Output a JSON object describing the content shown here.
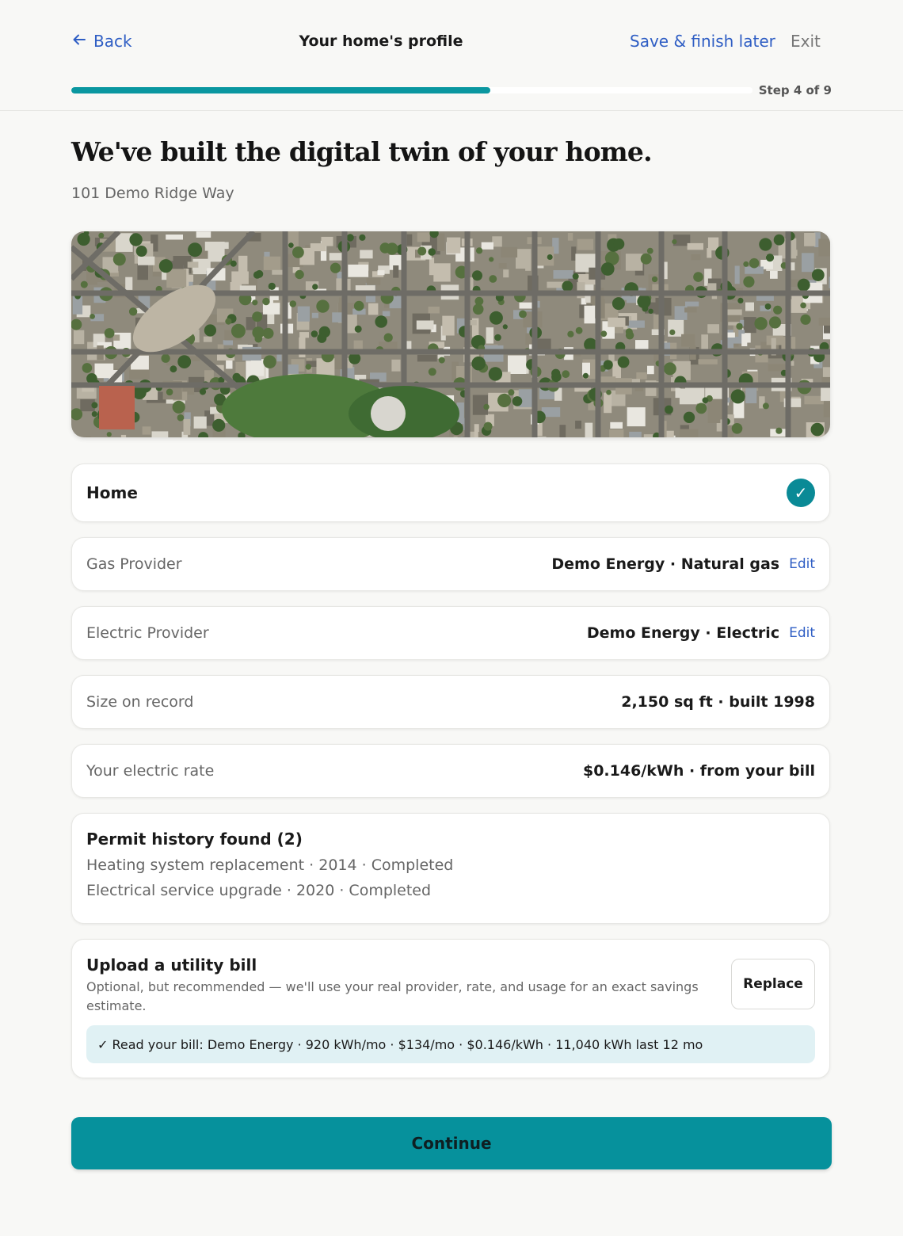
{
  "header": {
    "back_label": "Back",
    "title": "Your home's profile",
    "save_label": "Save & finish later",
    "exit_label": "Exit",
    "step_label": "Step 4 of 9",
    "progress": 0.615,
    "accent_color": "#0a97a0",
    "link_color": "#2f5ec4"
  },
  "hero": {
    "headline": "We've built the digital twin of your home.",
    "address": "101 Demo Ridge Way"
  },
  "home_card": {
    "label": "Home",
    "checked": true
  },
  "gas": {
    "label": "Gas Provider",
    "value": "Demo Energy · Natural gas",
    "edit_label": "Edit"
  },
  "electric": {
    "label": "Electric Provider",
    "value": "Demo Energy · Electric",
    "edit_label": "Edit"
  },
  "size": {
    "label": "Size on record",
    "value": "2,150 sq ft · built 1998"
  },
  "rate": {
    "label": "Your electric rate",
    "value": "$0.146/kWh · from your bill"
  },
  "permits": {
    "title": "Permit history found (2)",
    "items": [
      "Heating system replacement · 2014 · Completed",
      "Electrical service upgrade · 2020 · Completed"
    ]
  },
  "upload": {
    "title": "Upload a utility bill",
    "description": "Optional, but recommended — we'll use your real provider, rate, and usage for an exact savings estimate.",
    "replace_label": "Replace",
    "readout": "✓ Read your bill: Demo Energy · 920 kWh/mo · $134/mo · $0.146/kWh · 11,040 kWh last 12 mo"
  },
  "continue_label": "Continue"
}
